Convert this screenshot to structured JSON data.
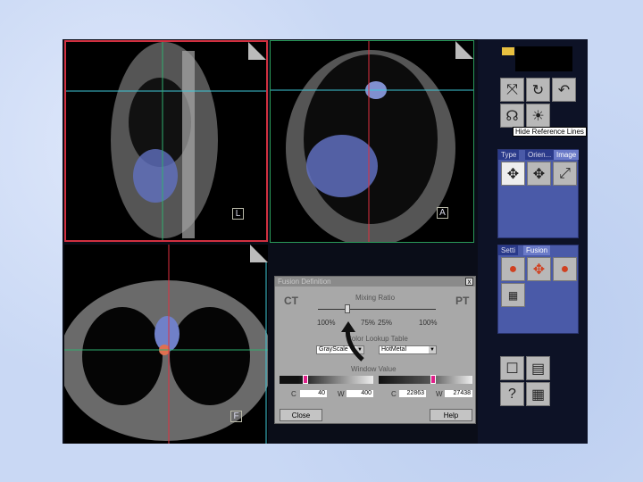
{
  "viewports": {
    "sagittal": {
      "orientation": "L",
      "border_color": "#d03040"
    },
    "coronal": {
      "orientation": "A",
      "border_color": "#2a9a5a"
    },
    "axial": {
      "orientation": "F",
      "border_color": "#1a1a1a"
    }
  },
  "toolbar": {
    "icons": [
      "rotate-3d-icon",
      "rotate-free-icon",
      "rotate-icon",
      "hide-reference-lines-icon",
      "brightness-icon"
    ],
    "tooltip": "Hide Reference Lines"
  },
  "panel1": {
    "tabs": [
      "Type",
      "Orien...",
      "Image"
    ],
    "active_tab": "Image"
  },
  "panel2": {
    "tabs": [
      "Setti",
      "Fusion"
    ],
    "active_tab": "Fusion"
  },
  "fusion_dialog": {
    "title": "Fusion Definition",
    "close_x": "x",
    "left_label": "CT",
    "right_label": "PT",
    "mixing_ratio_label": "Mixing Ratio",
    "mixing_ratio_ct_percent": 75,
    "ticks": [
      "100%",
      "75%",
      "25%",
      "100%"
    ],
    "color_lookup_label": "Color Lookup Table",
    "ct_lut": "GrayScale",
    "pt_lut": "HotMetal",
    "window_value_label": "Window Value",
    "ct": {
      "c_label": "C",
      "c": "40",
      "w_label": "W",
      "w": "400"
    },
    "pt": {
      "c_label": "C",
      "c": "22863",
      "w_label": "W",
      "w": "27438"
    },
    "close_button": "Close",
    "help_button": "Help"
  },
  "colors": {
    "crosshair_cyan": "#3ec8d8",
    "crosshair_red": "#e03040",
    "crosshair_green": "#30b070",
    "panel_blue": "#4a5aa8"
  }
}
